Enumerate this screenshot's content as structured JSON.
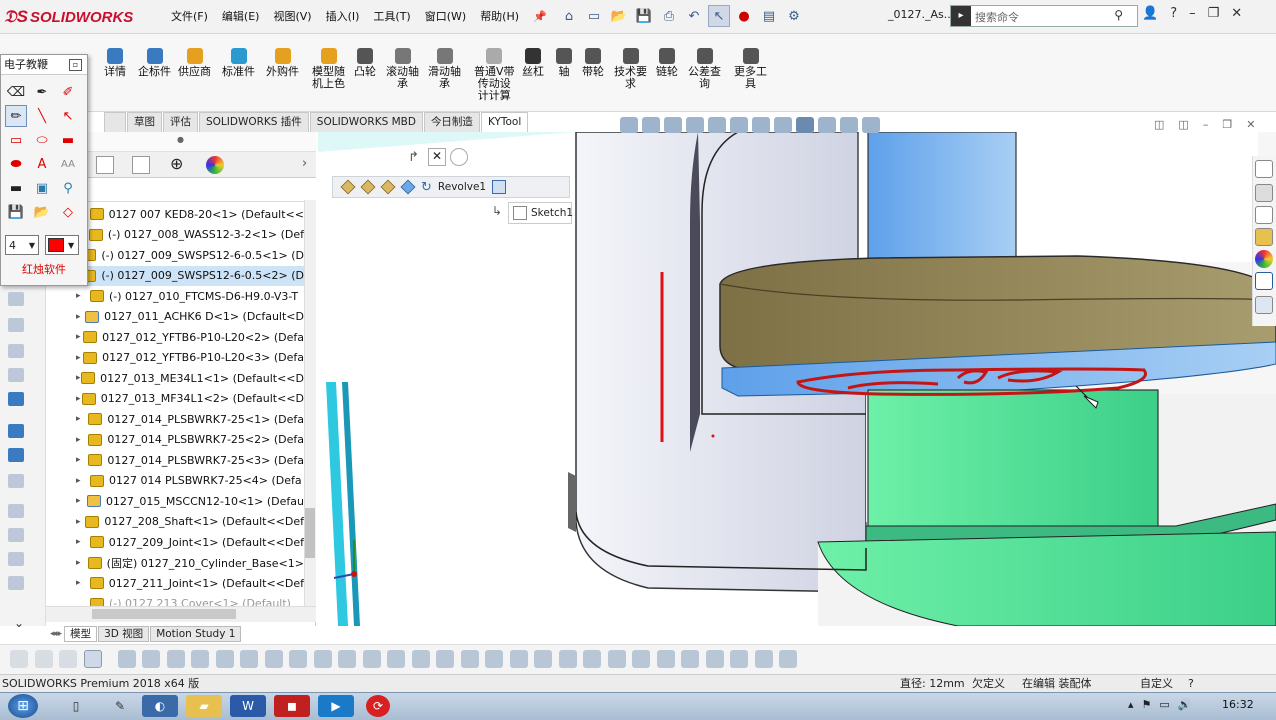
{
  "app": {
    "name": "SOLIDWORKS",
    "doc_title": "_0127._As..."
  },
  "menu": [
    "文件(F)",
    "编辑(E)",
    "视图(V)",
    "插入(I)",
    "工具(T)",
    "窗口(W)",
    "帮助(H)"
  ],
  "search": {
    "placeholder": "搜索命令"
  },
  "ribbon": {
    "items": [
      "详情",
      "企标件",
      "供应商",
      "标准件",
      "外购件",
      "模型随\n机上色",
      "凸轮",
      "滚动轴\n承",
      "滑动轴\n承",
      "普通V带\n传动设\n计计算",
      "丝杠",
      "轴",
      "带轮",
      "技术要\n求",
      "链轮",
      "公差查\n询",
      "更多工\n具"
    ],
    "colors": [
      "#3a7ac0",
      "#3a7ac0",
      "#e6a020",
      "#2a9ad0",
      "#e6a020",
      "#e6a020",
      "#555555",
      "#777777",
      "#777777",
      "#aaaaaa",
      "#333333",
      "#555555",
      "#555555",
      "#555555",
      "#555555",
      "#555555",
      "#555555"
    ]
  },
  "tabs": [
    "草图",
    "评估",
    "SOLIDWORKS 插件",
    "SOLIDWORKS MBD",
    "今日制造",
    "KYTool"
  ],
  "active_tab": "KYTool",
  "drawing_panel": {
    "title": "电子教鞭",
    "line_width": "4",
    "brand": "红烛软件",
    "pen_color": "#ff0000"
  },
  "tree": {
    "rows": [
      {
        "label": "0127 007 KED8-20<1> (Default<<",
        "expand": false,
        "selected": false
      },
      {
        "label": "(-) 0127_008_WASS12-3-2<1> (Def",
        "expand": false,
        "selected": false
      },
      {
        "label": "(-) 0127_009_SWSPS12-6-0.5<1> (D",
        "expand": false,
        "selected": false
      },
      {
        "label": "(-) 0127_009_SWSPS12-6-0.5<2> (D",
        "expand": false,
        "selected": true
      },
      {
        "label": "(-) 0127_010_FTCMS-D6-H9.0-V3-T",
        "expand": true,
        "selected": false
      },
      {
        "label": "0127_011_ACHK6 D<1> (Dcfault<D",
        "expand": true,
        "selected": false
      },
      {
        "label": "0127_012_YFTB6-P10-L20<2> (Defa",
        "expand": true,
        "selected": false
      },
      {
        "label": "0127_012_YFTB6-P10-L20<3> (Defa",
        "expand": true,
        "selected": false
      },
      {
        "label": "0127_013_ME34L1<1> (Default<<D",
        "expand": true,
        "selected": false
      },
      {
        "label": "0127_013_MF34L1<2> (Default<<D",
        "expand": true,
        "selected": false
      },
      {
        "label": "0127_014_PLSBWRK7-25<1> (Defa",
        "expand": true,
        "selected": false
      },
      {
        "label": "0127_014_PLSBWRK7-25<2> (Defa",
        "expand": true,
        "selected": false
      },
      {
        "label": "0127_014_PLSBWRK7-25<3> (Defa",
        "expand": true,
        "selected": false
      },
      {
        "label": "0127 014 PLSBWRK7-25<4> (Defa",
        "expand": true,
        "selected": false
      },
      {
        "label": "0127_015_MSCCN12-10<1> (Defau",
        "expand": true,
        "selected": false
      },
      {
        "label": "0127_208_Shaft<1> (Default<<Def",
        "expand": true,
        "selected": false
      },
      {
        "label": "0127_209_Joint<1> (Default<<Def",
        "expand": true,
        "selected": false
      },
      {
        "label": "(固定) 0127_210_Cylinder_Base<1>",
        "expand": true,
        "selected": false
      },
      {
        "label": "0127_211_Joint<1> (Default<<Def",
        "expand": true,
        "selected": false
      },
      {
        "label": "(-) 0127 213 Cover<1> (Default)",
        "expand": false,
        "selected": false
      }
    ]
  },
  "feature_breadcrumb": {
    "feature": "Revolve1",
    "sketch": "Sketch1"
  },
  "bottom_tabs": [
    "模型",
    "3D 视图",
    "Motion Study 1"
  ],
  "status": {
    "product": "SOLIDWORKS Premium 2018 x64 版",
    "diameter": "直径: 12mm",
    "definition": "欠定义",
    "mode": "在编辑 装配体",
    "units": "自定义",
    "help": "?"
  },
  "clock": "16:32"
}
